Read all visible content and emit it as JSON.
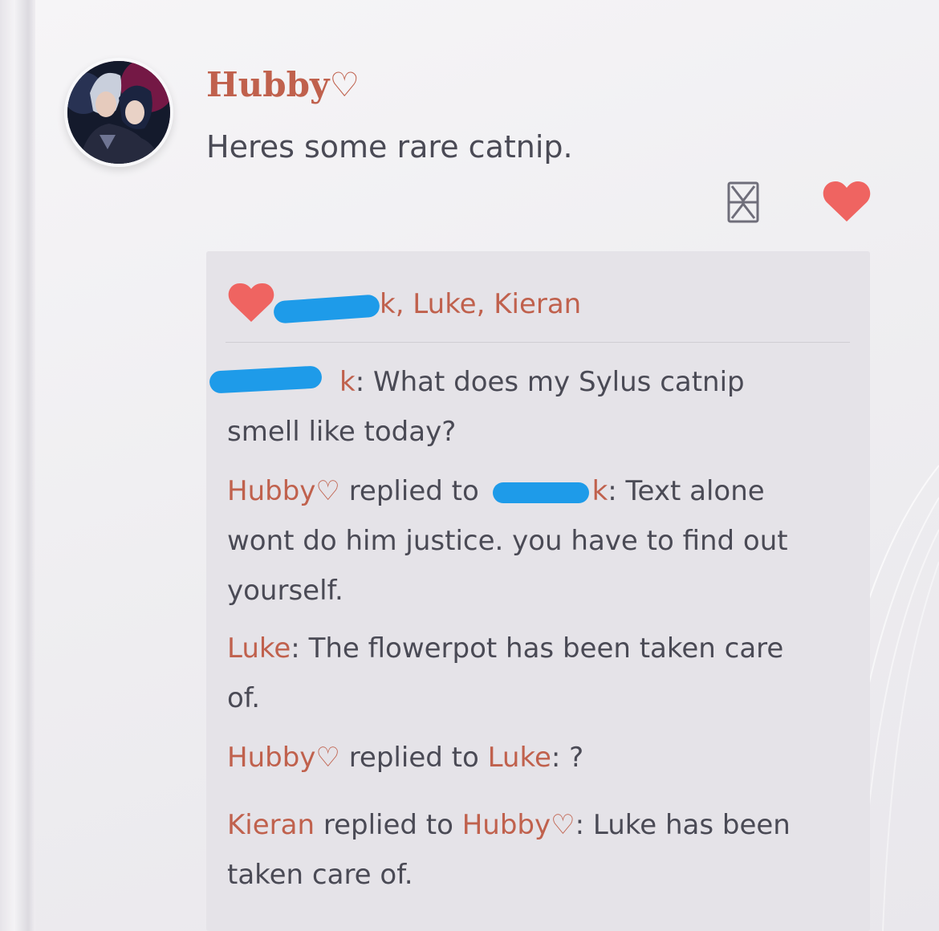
{
  "post": {
    "sender": "Hubby♡",
    "message": "Heres some rare catnip."
  },
  "icons": {
    "hourglass": "hourglass-icon",
    "like": "heart-icon"
  },
  "colors": {
    "name_accent": "#c0614d",
    "heart": "#ef6461",
    "redaction": "#1e9be9",
    "text": "#4a4a55"
  },
  "likes": {
    "names_visible": "k, Luke, Kieran"
  },
  "comments": [
    {
      "author_visible": "k",
      "separator": ": ",
      "text": "What does my Sylus catnip smell like today?"
    },
    {
      "author": "Hubby♡",
      "replied_to_label": " replied to ",
      "target_visible": "k",
      "separator": ": ",
      "text": "Text alone wont do him justice. you have to find out yourself."
    },
    {
      "author": "Luke",
      "separator": ": ",
      "text": "The flowerpot has been taken care of."
    },
    {
      "author": "Hubby♡",
      "replied_to_label": " replied to ",
      "target": "Luke",
      "separator": ": ",
      "text": "?"
    },
    {
      "author": "Kieran",
      "replied_to_label": " replied to ",
      "target": "Hubby♡",
      "separator": ": ",
      "text": "Luke has been taken care of."
    }
  ]
}
